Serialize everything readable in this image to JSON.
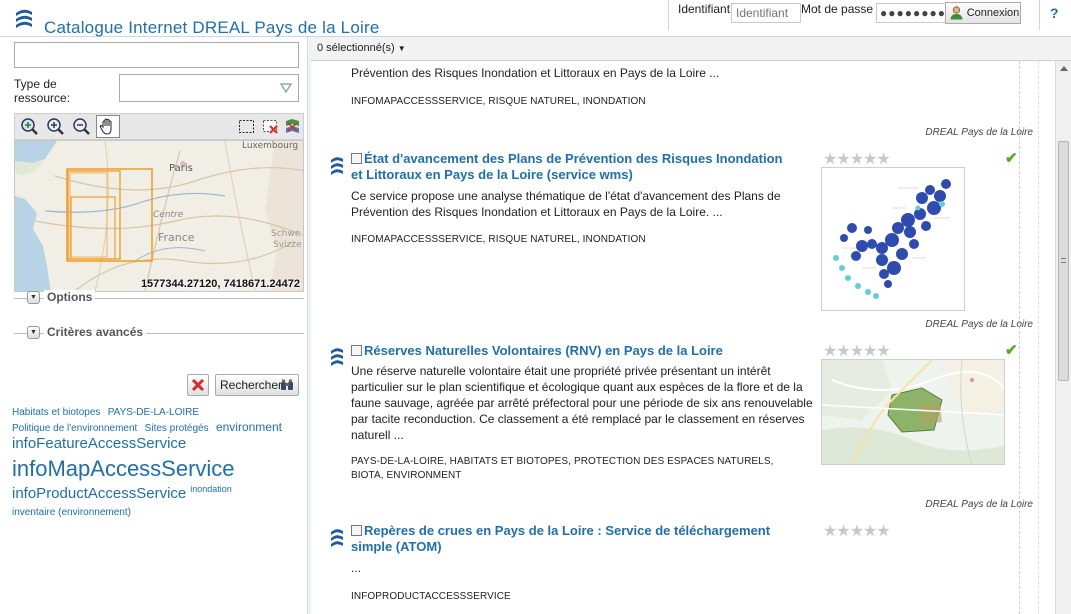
{
  "header": {
    "title": "Catalogue Internet DREAL Pays de la Loire",
    "login_label": "Identifiant",
    "login_placeholder": "Identifiant",
    "password_label": "Mot de passe",
    "password_value": "●●●●●●●●●",
    "login_button": "Connexion",
    "help": "?"
  },
  "search": {
    "query": "",
    "type_label": "Type de ressource:",
    "type_value": ""
  },
  "map": {
    "coords": "1577344.27120, 7418671.24472",
    "place_labels": [
      "Luxembourg",
      "Paris",
      "Centre",
      "France",
      "Schwe",
      "Svizze"
    ]
  },
  "panels": {
    "options": "Options",
    "advanced": "Critères avancés"
  },
  "actions": {
    "search_button": "Rechercher"
  },
  "tags": [
    {
      "label": "Habitats et biotopes",
      "size": 10
    },
    {
      "label": "PAYS-DE-LA-LOIRE",
      "size": 10
    },
    {
      "label": "Politique de l'environnement",
      "size": 10
    },
    {
      "label": "Sites protégés",
      "size": 10
    },
    {
      "label": "environment",
      "size": 12
    },
    {
      "label": "infoFeatureAccessService",
      "size": 15
    },
    {
      "label": "infoMapAccessService",
      "size": 22
    },
    {
      "label": "infoProductAccessService",
      "size": 15
    },
    {
      "label": "inondation",
      "size": 9
    },
    {
      "label": "inventaire (environnement)",
      "size": 10
    }
  ],
  "toolbar": {
    "selected": "0 sélectionné(s)"
  },
  "results": {
    "r0": {
      "abstract": "Prévention des Risques Inondation et Littoraux en Pays de la Loire ...",
      "keywords": "INFOMAPACCESSSERVICE, RISQUE NATUREL, INONDATION",
      "organization": "DREAL Pays de la Loire"
    },
    "r1": {
      "title": "État d'avancement des Plans de Prévention des Risques Inondation et Littoraux en Pays de la Loire (service wms)",
      "abstract": "Ce service propose une analyse thématique de l'état d'avancement des Plans de Prévention des Risques Inondation et Littoraux en Pays de la Loire. ...",
      "keywords": "INFOMAPACCESSSERVICE, RISQUE NATUREL, INONDATION",
      "organization": "DREAL Pays de la Loire",
      "stars": "★★★★★",
      "check": "✔"
    },
    "r2": {
      "title": "Réserves Naturelles Volontaires (RNV) en Pays de la Loire",
      "abstract": "Une réserve naturelle volontaire était une propriété privée présentant un intérêt particulier sur le plan scientifique et écologique quant aux espèces de la flore et de la faune sauvage, agréée par arrêté préfectoral pour une période de six ans renouvelable par tacite reconduction. Ce classement a été remplacé par le classement en réserves naturell ...",
      "keywords": "PAYS-DE-LA-LOIRE, HABITATS ET BIOTOPES, PROTECTION DES ESPACES NATURELS, BIOTA, ENVIRONMENT",
      "organization": "DREAL Pays de la Loire",
      "stars": "★★★★★",
      "check": "✔"
    },
    "r3": {
      "title": "Repères de crues en Pays de la Loire : Service de téléchargement simple (ATOM)",
      "abstract": "...",
      "keywords": "INFOPRODUCTACCESSSERVICE",
      "stars": "★★★★★"
    }
  }
}
